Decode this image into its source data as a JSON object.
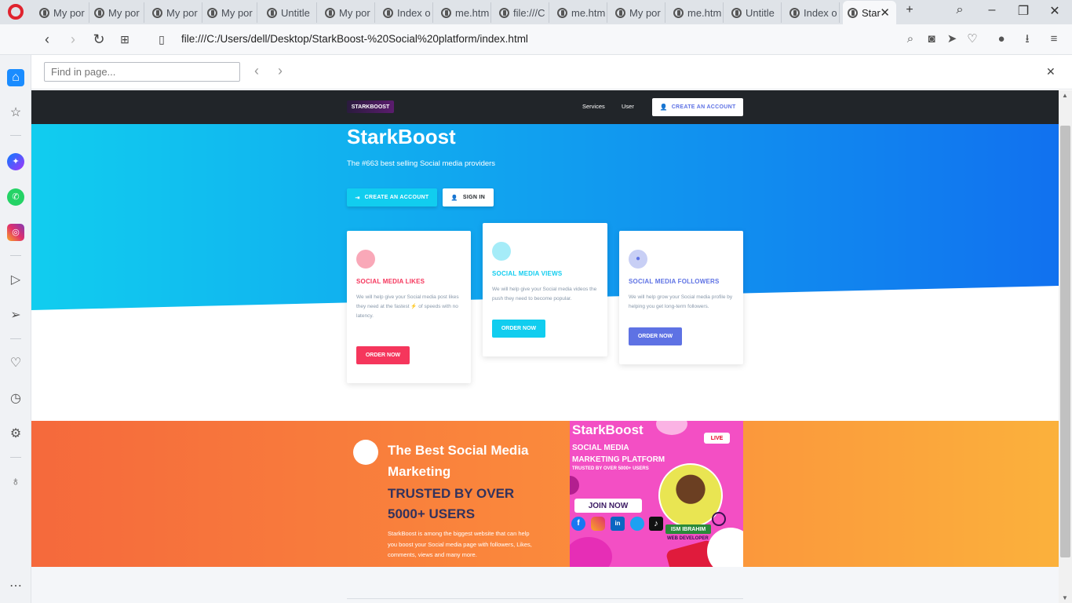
{
  "browser": {
    "tabs": [
      {
        "label": "My por"
      },
      {
        "label": "My por"
      },
      {
        "label": "My por"
      },
      {
        "label": "My por"
      },
      {
        "label": "Untitle"
      },
      {
        "label": "My por"
      },
      {
        "label": "Index o"
      },
      {
        "label": "me.htm"
      },
      {
        "label": "file:///C"
      },
      {
        "label": "me.htm"
      },
      {
        "label": "My por"
      },
      {
        "label": "me.htm"
      },
      {
        "label": "Untitle"
      },
      {
        "label": "Index o"
      },
      {
        "label": "Star"
      }
    ],
    "url": "file:///C:/Users/dell/Desktop/StarkBoost-%20Social%20platform/index.html",
    "find_placeholder": "Find in page..."
  },
  "site": {
    "logo_text": "STARKBOOST",
    "nav": {
      "services": "Services",
      "user": "User",
      "create_account": "CREATE AN ACCOUNT"
    },
    "hero": {
      "title": "StarkBoost",
      "subtitle": "The #663 best selling Social media providers",
      "create_btn": "CREATE AN ACCOUNT",
      "signin_btn": "SIGN IN"
    },
    "cards": [
      {
        "title": "SOCIAL MEDIA LIKES",
        "desc": "We will help give your Social media post likes they need at the fastest ⚡ of speeds with no latency.",
        "button": "ORDER NOW",
        "color": "#f5365c",
        "light": "#f9a8b8"
      },
      {
        "title": "SOCIAL MEDIA VIEWS",
        "desc": "We will help give your Social media videos the push they need to become popular.",
        "button": "ORDER NOW",
        "color": "#11cdef",
        "light": "#a5ecf8"
      },
      {
        "title": "SOCIAL MEDIA FOLLOWERS",
        "desc": "We will help grow your Social media profile by helping you get long-term followers.",
        "button": "ORDER NOW",
        "color": "#5e72e4",
        "light": "#c8cff5"
      }
    ],
    "promo": {
      "heading": "The Best Social Media Marketing",
      "subheading": "TRUSTED BY OVER 5000+ USERS",
      "text": "StarkBoost is among the biggest website that can help you boost your Social media page with followers, Likes, comments, views and many more."
    },
    "ad": {
      "brand": "StarkBoost",
      "line1": "SOCIAL MEDIA",
      "line2": "MARKETING PLATFORM",
      "line3": "TRUSTED BY OVER 5000+ USERS",
      "live": "LIVE",
      "join": "JOIN NOW",
      "name": "ISM IBRAHIM",
      "role": "WEB DEVELOPER"
    }
  }
}
